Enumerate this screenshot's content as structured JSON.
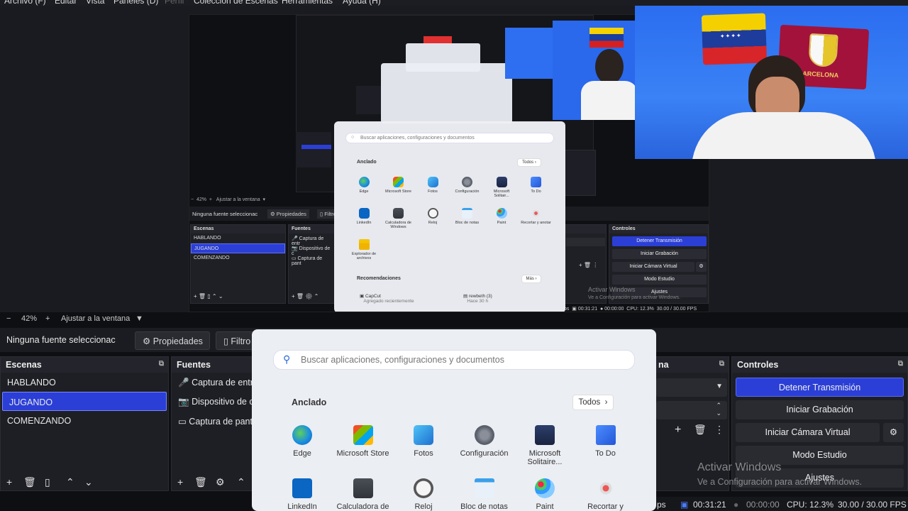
{
  "menu": [
    "Archivo (F)",
    "Editar",
    "Vista",
    "Paneles (D)",
    "Perfil",
    "Colección de Escenas",
    "Herramientas",
    "Ayuda (H)"
  ],
  "zoom": {
    "minus": "−",
    "value": "42%",
    "plus": "+",
    "fit": "Ajustar a la ventana",
    "arrow": "▼"
  },
  "props": {
    "no_source": "Ninguna fuente seleccionac",
    "properties": "Propiedades",
    "filters": "Filtro"
  },
  "scenes": {
    "title": "Escenas",
    "items": [
      "HABLANDO",
      "JUGANDO",
      "COMENZANDO"
    ],
    "selected": 1
  },
  "sources": {
    "title": "Fuentes",
    "items": [
      "Captura de entra",
      "Dispositivo de ca",
      "Captura de pant"
    ]
  },
  "mixer": {
    "title": "na"
  },
  "controls": {
    "title": "Controles",
    "stop_stream": "Detener Transmisión",
    "start_record": "Iniciar Grabación",
    "virtual_cam": "Iniciar Cámara Virtual",
    "studio_mode": "Modo Estudio",
    "settings": "Ajustes"
  },
  "startmenu": {
    "search_placeholder": "Buscar aplicaciones, configuraciones y documentos",
    "pinned": "Anclado",
    "all": "Todos",
    "recommended": "Recomendaciones",
    "more": "Más",
    "apps": [
      "Edge",
      "Microsoft Store",
      "Fotos",
      "Configuración",
      "Microsoft Solitaire...",
      "To Do",
      "LinkedIn",
      "Calculadora de",
      "Reloj",
      "Bloc de notas",
      "Paint",
      "Recortar y"
    ],
    "apps_small": [
      "Edge",
      "Microsoft Store",
      "Fotos",
      "Configuración",
      "Microsoft Solitair...",
      "To Do",
      "LinkedIn",
      "Calculadora de Windows",
      "Reloj",
      "Bloc de notas",
      "Paint",
      "Recortar y anotar",
      "Explorador de archivos"
    ],
    "rec_items": [
      {
        "name": "CapCut",
        "sub": "Agregado recientemente"
      },
      {
        "name": "rewbeth (3)",
        "sub": "Hace 30 h"
      }
    ]
  },
  "status": {
    "fps_tail": "ps",
    "stream_time": "00:31:21",
    "rec_time": "00:00:00",
    "cpu": "CPU: 12.3%",
    "fps": "30.00 / 30.00 FPS"
  },
  "watermark": {
    "line1": "Activar Windows",
    "line2": "Ve a Configuración para activar Windows."
  },
  "webcam": {
    "shirt_text": "BARCELONA"
  },
  "colors": {
    "accent": "#2b3fd6",
    "dock_bg": "#1e1f25",
    "webcam_bg": "#2b6df0"
  }
}
